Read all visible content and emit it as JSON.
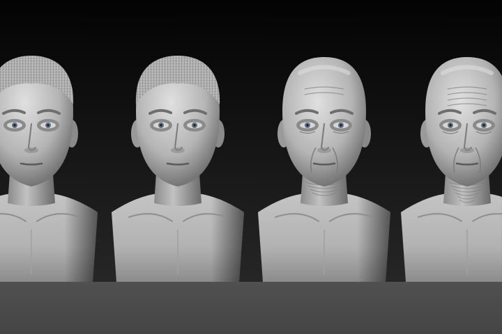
{
  "scene": {
    "bust_count": 4,
    "subject": "sculpted-head-busts-aging-sequence",
    "colors": {
      "background_top": "#030303",
      "background_bottom": "#242424",
      "floor": "#4a4a4a",
      "skin_light": "#d8d8d8",
      "skin_mid": "#9c9c9c",
      "skin_dark": "#3c3c3c",
      "eye_iris": "#5a6f88"
    }
  },
  "busts": [
    {
      "stage": "young",
      "hair": "short-cropped",
      "wrinkles": 0
    },
    {
      "stage": "young-adult",
      "hair": "short-cropped",
      "wrinkles": 0
    },
    {
      "stage": "middle-aged",
      "hair": "bald",
      "wrinkles": 1
    },
    {
      "stage": "elderly",
      "hair": "bald",
      "wrinkles": 2
    }
  ]
}
